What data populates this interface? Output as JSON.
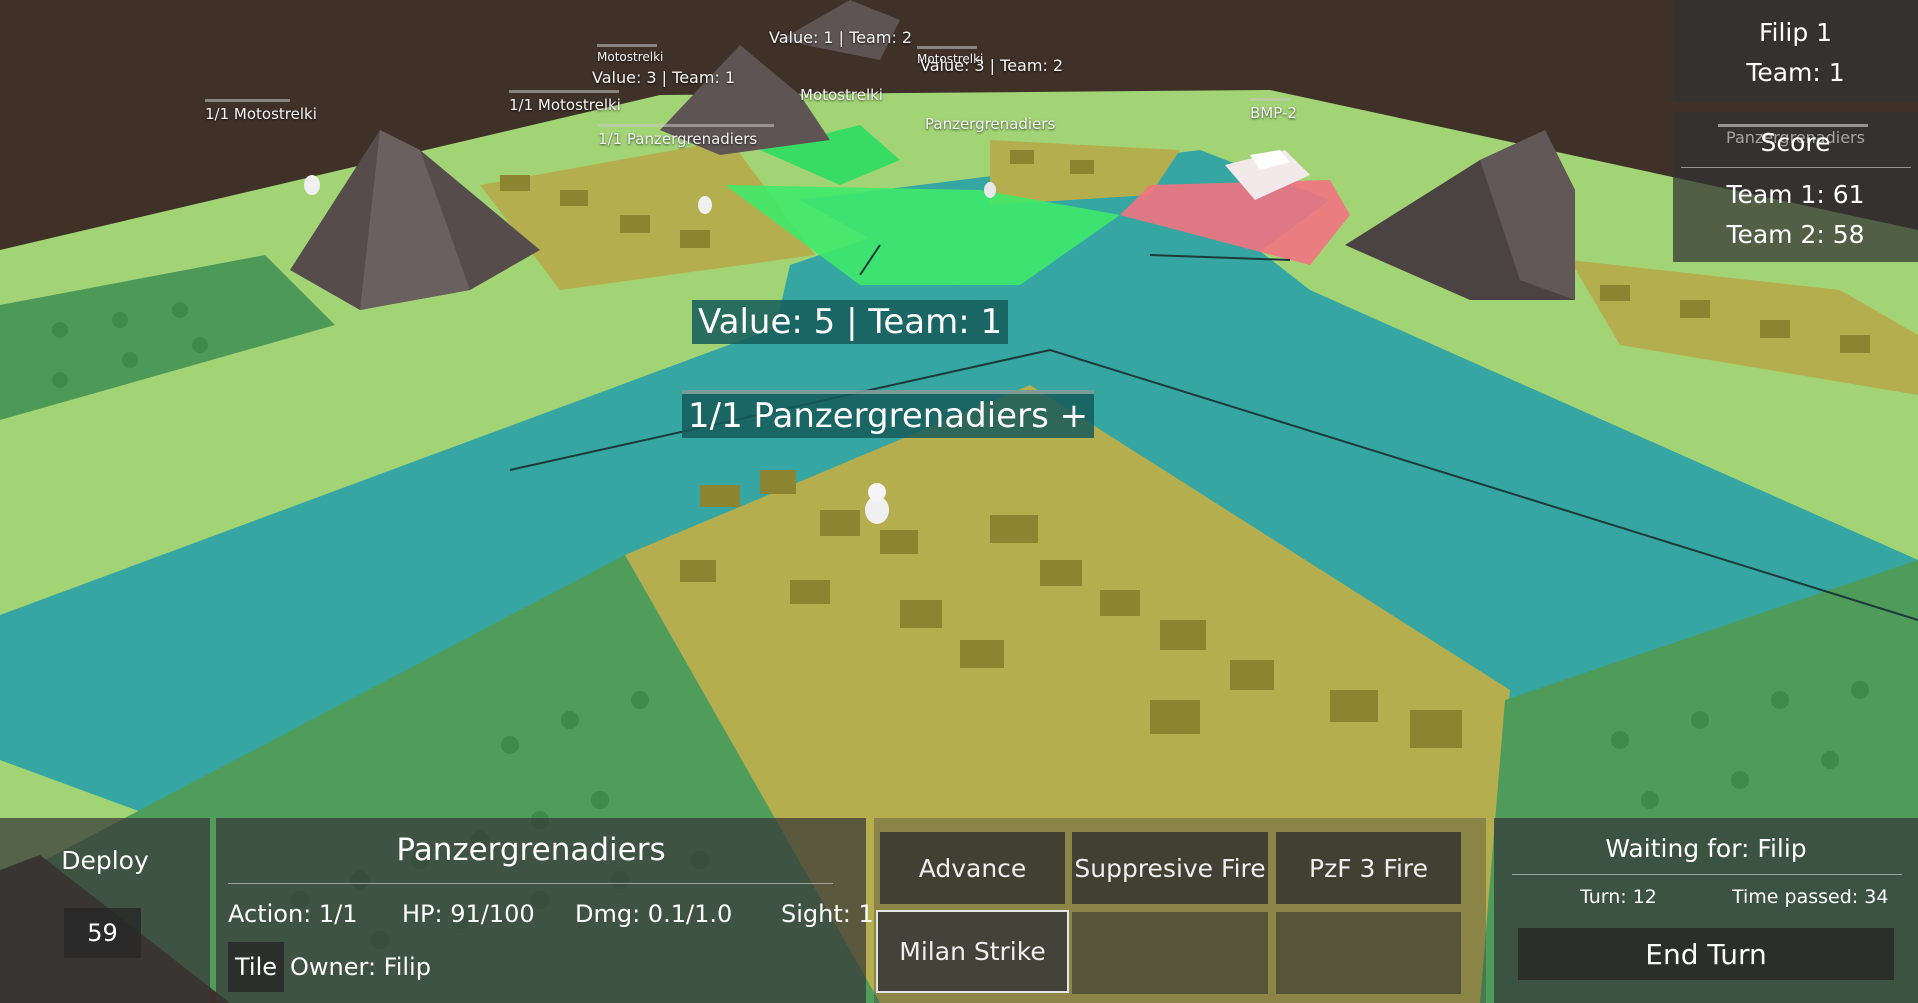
{
  "player": {
    "name": "Filip 1",
    "team": "Team: 1"
  },
  "score": {
    "ghost_label": "Panzergrenadiers",
    "title": "Score",
    "team1": "Team 1: 61",
    "team2": "Team 2: 58"
  },
  "map_labels": {
    "units": [
      {
        "text": "1/1 Motostrelki"
      },
      {
        "text": "1/1 Motostrelki"
      },
      {
        "text": "Motostrelki"
      },
      {
        "text": "Motostrelki"
      },
      {
        "text": "1/1 Panzergrenadiers"
      },
      {
        "text": "Motostrelki"
      },
      {
        "text": "Panzergrenadiers"
      },
      {
        "text": "BMP-2"
      }
    ],
    "values": [
      {
        "text": "Value: 1 | Team: 2"
      },
      {
        "text": "Value: 3 | Team: 1"
      },
      {
        "text": "Value: 3 | Team: 2"
      }
    ],
    "selected_value": "Value: 5 | Team: 1",
    "selected_unit": "1/1 Panzergrenadiers",
    "selected_unit_plus": "+"
  },
  "deploy": {
    "label": "Deploy",
    "count": "59"
  },
  "unit_panel": {
    "name": "Panzergrenadiers",
    "action": "Action: 1/1",
    "hp": "HP: 91/100",
    "dmg": "Dmg: 0.1/1.0",
    "sight": "Sight: 1",
    "tile_button": "Tile",
    "owner": "Owner: Filip"
  },
  "actions": {
    "advance": "Advance",
    "suppressive": "Suppresive Fire",
    "pzf": "PzF 3 Fire",
    "milan": "Milan Strike"
  },
  "turn_panel": {
    "waiting": "Waiting for: Filip",
    "turn": "Turn: 12",
    "time": "Time passed: 34",
    "end_turn": "End Turn"
  },
  "colors": {
    "grass": "#9fd273",
    "river": "#33a7a2",
    "town": "#b3ac4c",
    "forest": "#4e9b5a",
    "friendly_highlight": "#3fe96a",
    "enemy_highlight": "#f56b7b",
    "mountain": "#5b5050",
    "ground_dark": "#3f3128"
  }
}
